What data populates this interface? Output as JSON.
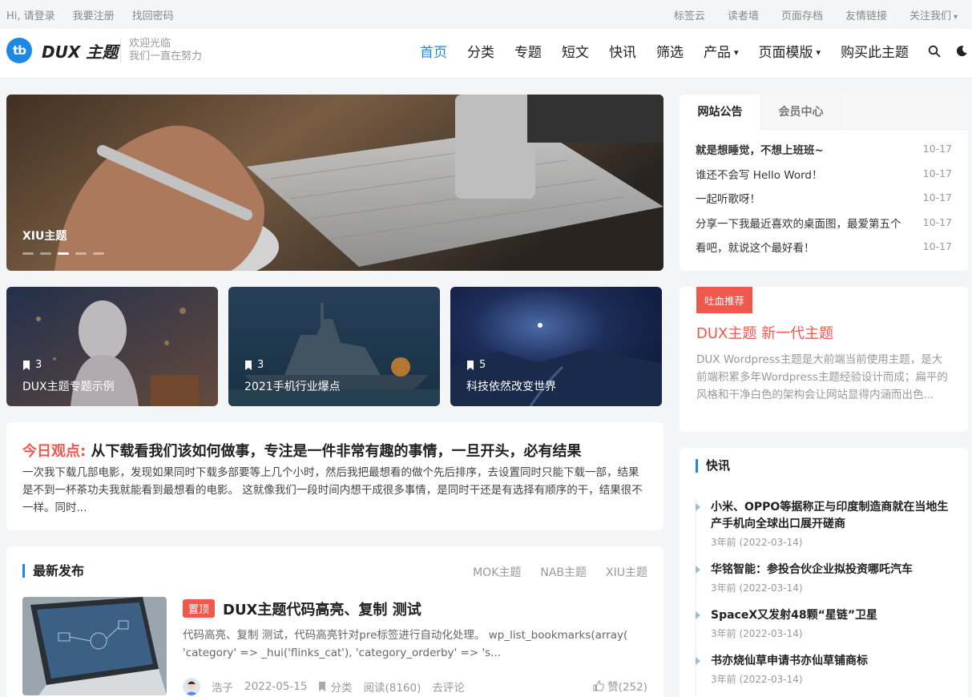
{
  "topbar": {
    "greeting": "Hi, 请登录",
    "register": "我要注册",
    "recover": "找回密码",
    "right_links": [
      "标签云",
      "读者墙",
      "页面存档",
      "友情链接",
      "关注我们"
    ]
  },
  "header": {
    "logo_text": "tb",
    "brand": "DUX 主题",
    "slogan_line1": "欢迎光临",
    "slogan_line2": "我们一直在努力",
    "nav": [
      "首页",
      "分类",
      "专题",
      "短文",
      "快讯",
      "筛选",
      "产品",
      "页面模版",
      "购买此主题"
    ],
    "active_nav": "首页"
  },
  "banner": {
    "title": "XIU主题",
    "slide_count": 5,
    "active_slide": 3
  },
  "topics": [
    {
      "count": "3",
      "title": "DUX主题专题示例"
    },
    {
      "count": "3",
      "title": "2021手机行业爆点"
    },
    {
      "count": "5",
      "title": "科技依然改变世界"
    }
  ],
  "viewpoint": {
    "prefix": "今日观点:",
    "title": "从下载看我们该如何做事，专注是一件非常有趣的事情，一旦开头，必有结果",
    "excerpt": "一次我下载几部电影，发现如果同时下载多部要等上几个小时，然后我把最想看的做个先后排序，去设置同时只能下载一部，结果是不到一杯茶功夫我就能看到最想看的电影。 这就像我们一段时间内想干成很多事情，是同时干还是有选择有顺序的干，结果很不一样。同时..."
  },
  "latest": {
    "title": "最新发布",
    "tabs": [
      "MOK主题",
      "NAB主题",
      "XIU主题"
    ],
    "post": {
      "badge": "置顶",
      "title": "DUX主题代码高亮、复制 测试",
      "excerpt": "代码高亮、复制 测试，代码高亮针对pre标签进行自动化处理。 wp_list_bookmarks(array( 'category' => _hui('flinks_cat'), 'category_orderby' => 's...",
      "author": "浩子",
      "date": "2022-05-15",
      "category": "分类",
      "views": "阅读(8160)",
      "comment": "去评论",
      "likes": "赞(252)"
    }
  },
  "notice": {
    "tabs": [
      "网站公告",
      "会员中心"
    ],
    "items": [
      {
        "title": "就是想睡觉，不想上班班~",
        "date": "10-17"
      },
      {
        "title": "谁还不会写 Hello Word！",
        "date": "10-17"
      },
      {
        "title": "一起听歌呀！",
        "date": "10-17"
      },
      {
        "title": "分享一下我最近喜欢的桌面图，最爱第五个",
        "date": "10-17"
      },
      {
        "title": "看吧，就说这个最好看！",
        "date": "10-17"
      }
    ]
  },
  "recommend": {
    "badge": "吐血推荐",
    "title": "DUX主题 新一代主题",
    "text": "DUX Wordpress主题是大前端当前使用主题，是大前端积累多年Wordpress主题经验设计而成；扁平的风格和干净白色的架构会让网站显得内涵而出色..."
  },
  "flash": {
    "title": "快讯",
    "items": [
      {
        "title": "小米、OPPO等据称正与印度制造商就在当地生产手机向全球出口展开磋商",
        "date": "3年前 (2022-03-14)"
      },
      {
        "title": "华铭智能：参投合伙企业拟投资哪吒汽车",
        "date": "3年前 (2022-03-14)"
      },
      {
        "title": "SpaceX又发射48颗“星链”卫星",
        "date": "3年前 (2022-03-14)"
      },
      {
        "title": "书亦烧仙草申请书亦仙草铺商标",
        "date": "3年前 (2022-03-14)"
      }
    ]
  },
  "colors": {
    "accent": "#1e88e5",
    "red": "#f0584d"
  },
  "icons": [
    "search-icon",
    "moon-icon",
    "bookmark-icon",
    "thumbs-up-icon"
  ]
}
